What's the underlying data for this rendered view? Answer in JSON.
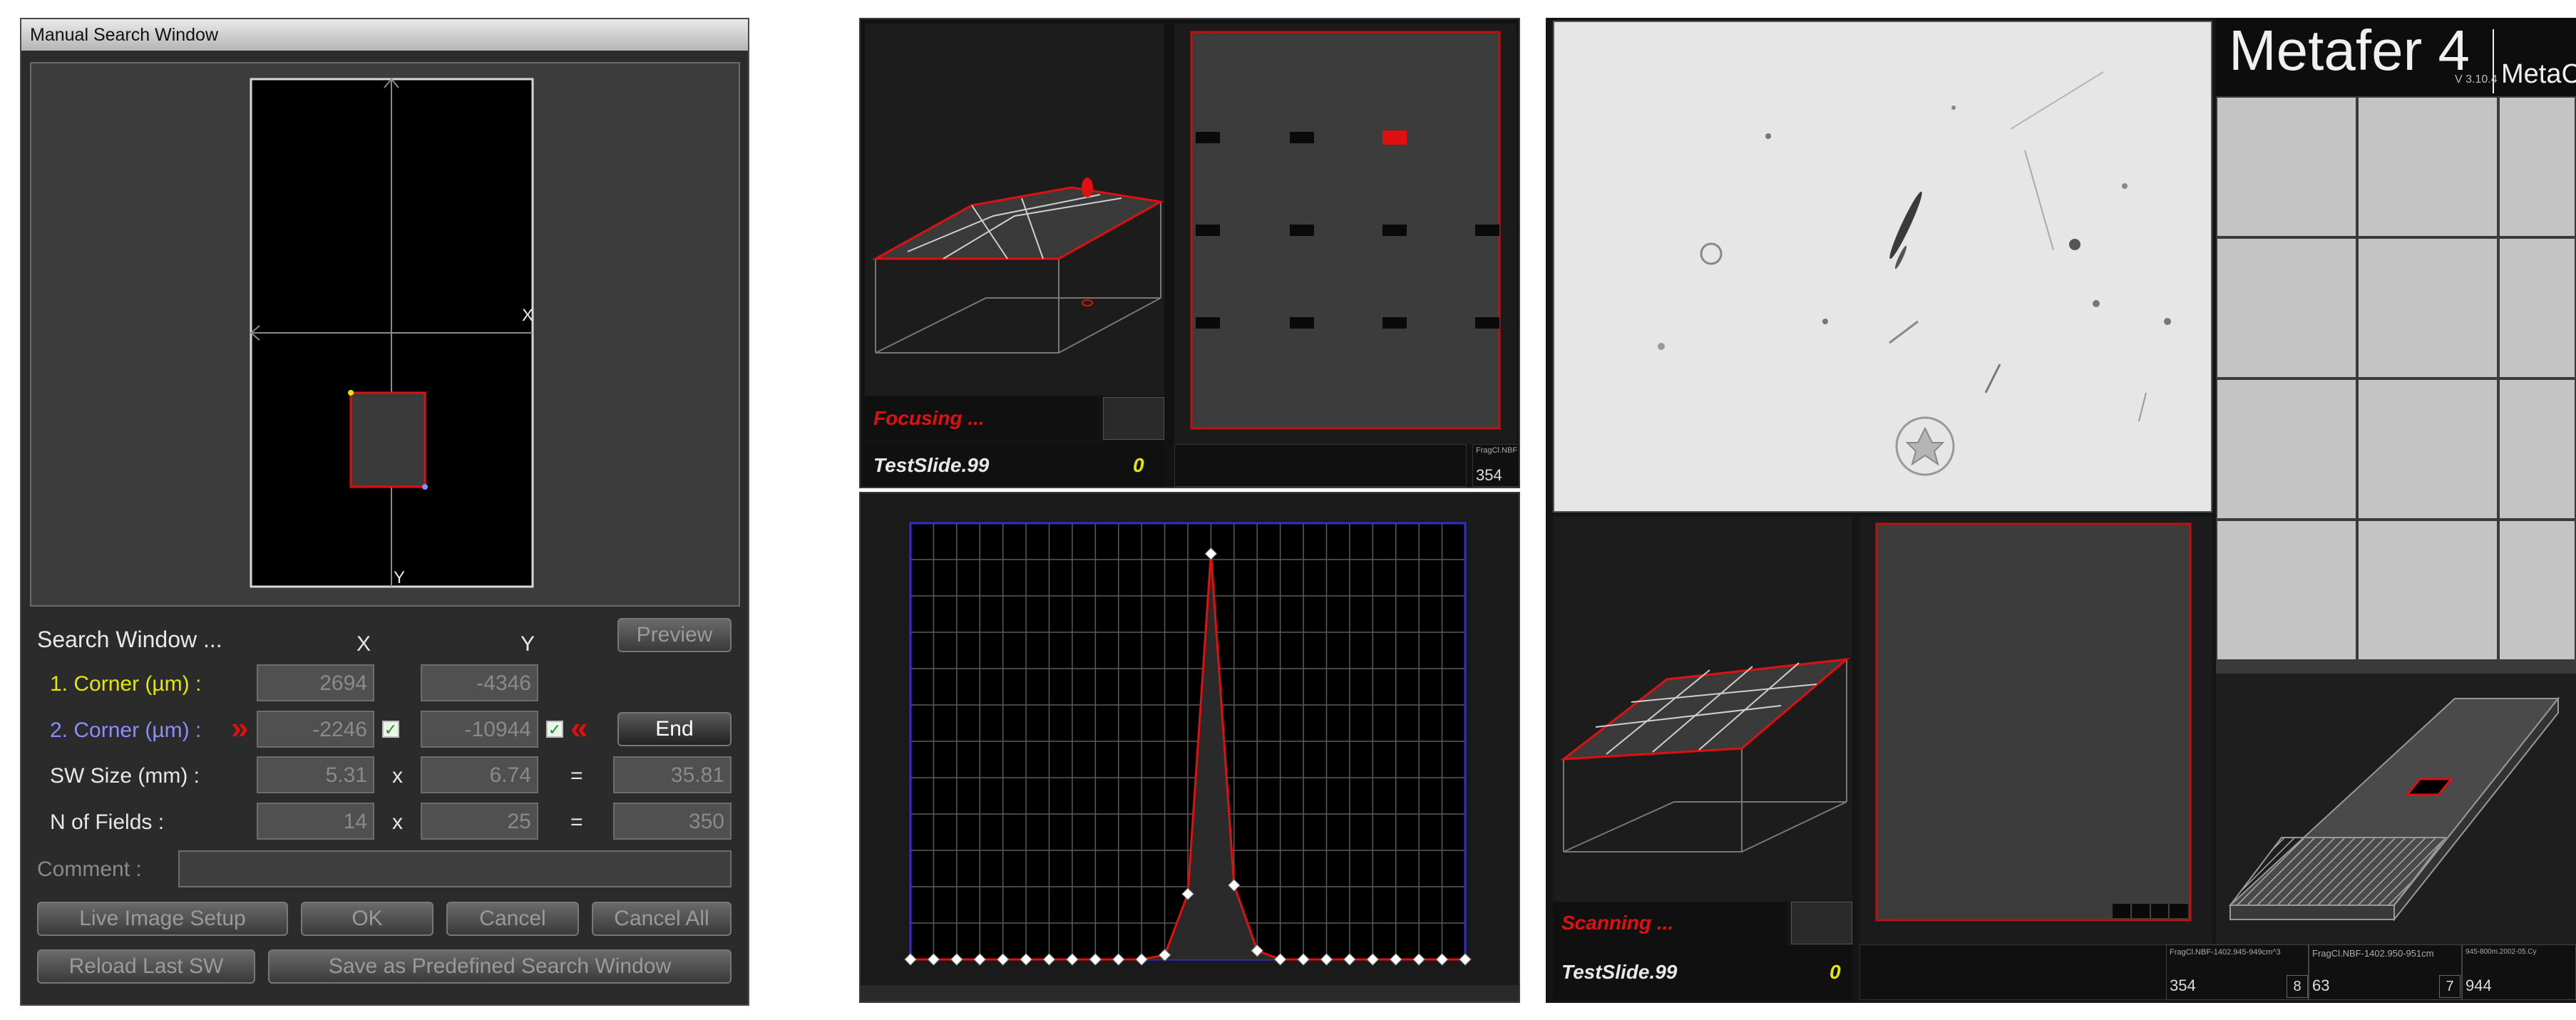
{
  "msw": {
    "title": "Manual Search Window",
    "axis_x": "X",
    "axis_y": "Y",
    "preview_button": "Preview",
    "section_title": "Search Window ...",
    "col_x": "X",
    "col_y": "Y",
    "corner1_label": "1. Corner (µm) :",
    "corner1_x": "2694",
    "corner1_y": "-4346",
    "corner2_label": "2. Corner (µm) :",
    "corner2_x": "-2246",
    "corner2_y": "-10944",
    "arrow_left": "»",
    "arrow_right": "«",
    "end_button": "End",
    "sw_size_label": "SW Size (mm) :",
    "sw_size_x": "5.31",
    "sw_size_y": "6.74",
    "sw_size_total": "35.81",
    "fields_label": "N of Fields :",
    "fields_x": "14",
    "fields_y": "25",
    "fields_total": "350",
    "times": "x",
    "equals": "=",
    "comment_label": "Comment :",
    "comment_value": "",
    "buttons": {
      "live_image_setup": "Live Image Setup",
      "ok": "OK",
      "cancel": "Cancel",
      "cancel_all": "Cancel All",
      "reload_last": "Reload Last SW",
      "save_predefined": "Save as Predefined Search Window"
    },
    "colors": {
      "corner1": "#e6e600",
      "corner2": "#8c8cff",
      "accent": "#e01010"
    }
  },
  "focus_panel": {
    "status": "Focusing ...",
    "slide_name": "TestSlide.99",
    "slide_count": "0",
    "side_small_label": "FragCl.NBF",
    "side_value": "354",
    "status_color": "#e01010"
  },
  "focus_chart": {
    "chart_data": {
      "type": "line",
      "title": "",
      "xlabel": "",
      "ylabel": "",
      "x": [
        0,
        1,
        2,
        3,
        4,
        5,
        6,
        7,
        8,
        9,
        10,
        11,
        12,
        13,
        14,
        15,
        16,
        17,
        18,
        19,
        20,
        21,
        22,
        23,
        24
      ],
      "series": [
        {
          "values": [
            0,
            0,
            0,
            0,
            0,
            0,
            0,
            0,
            0,
            0,
            0,
            0.01,
            0.15,
            0.93,
            0.17,
            0.02,
            0,
            0,
            0,
            0,
            0,
            0,
            0,
            0,
            0
          ]
        }
      ],
      "ylim": [
        0,
        1
      ],
      "grid": true
    }
  },
  "scan_panel": {
    "app_title": "Metafer 4",
    "app_subtitle": "MetaCy",
    "version": "V 3.10.4",
    "status": "Scanning ...",
    "slide_name": "TestSlide.99",
    "slide_count": "0",
    "info_labels": [
      "FragCl.NBF-1402.945-949cm^3",
      "FragCl.NBF-1402.950-951cm",
      "945-800m.2002-05.Cy"
    ],
    "info_values": [
      "354",
      "8",
      "63",
      "7",
      "944"
    ]
  }
}
